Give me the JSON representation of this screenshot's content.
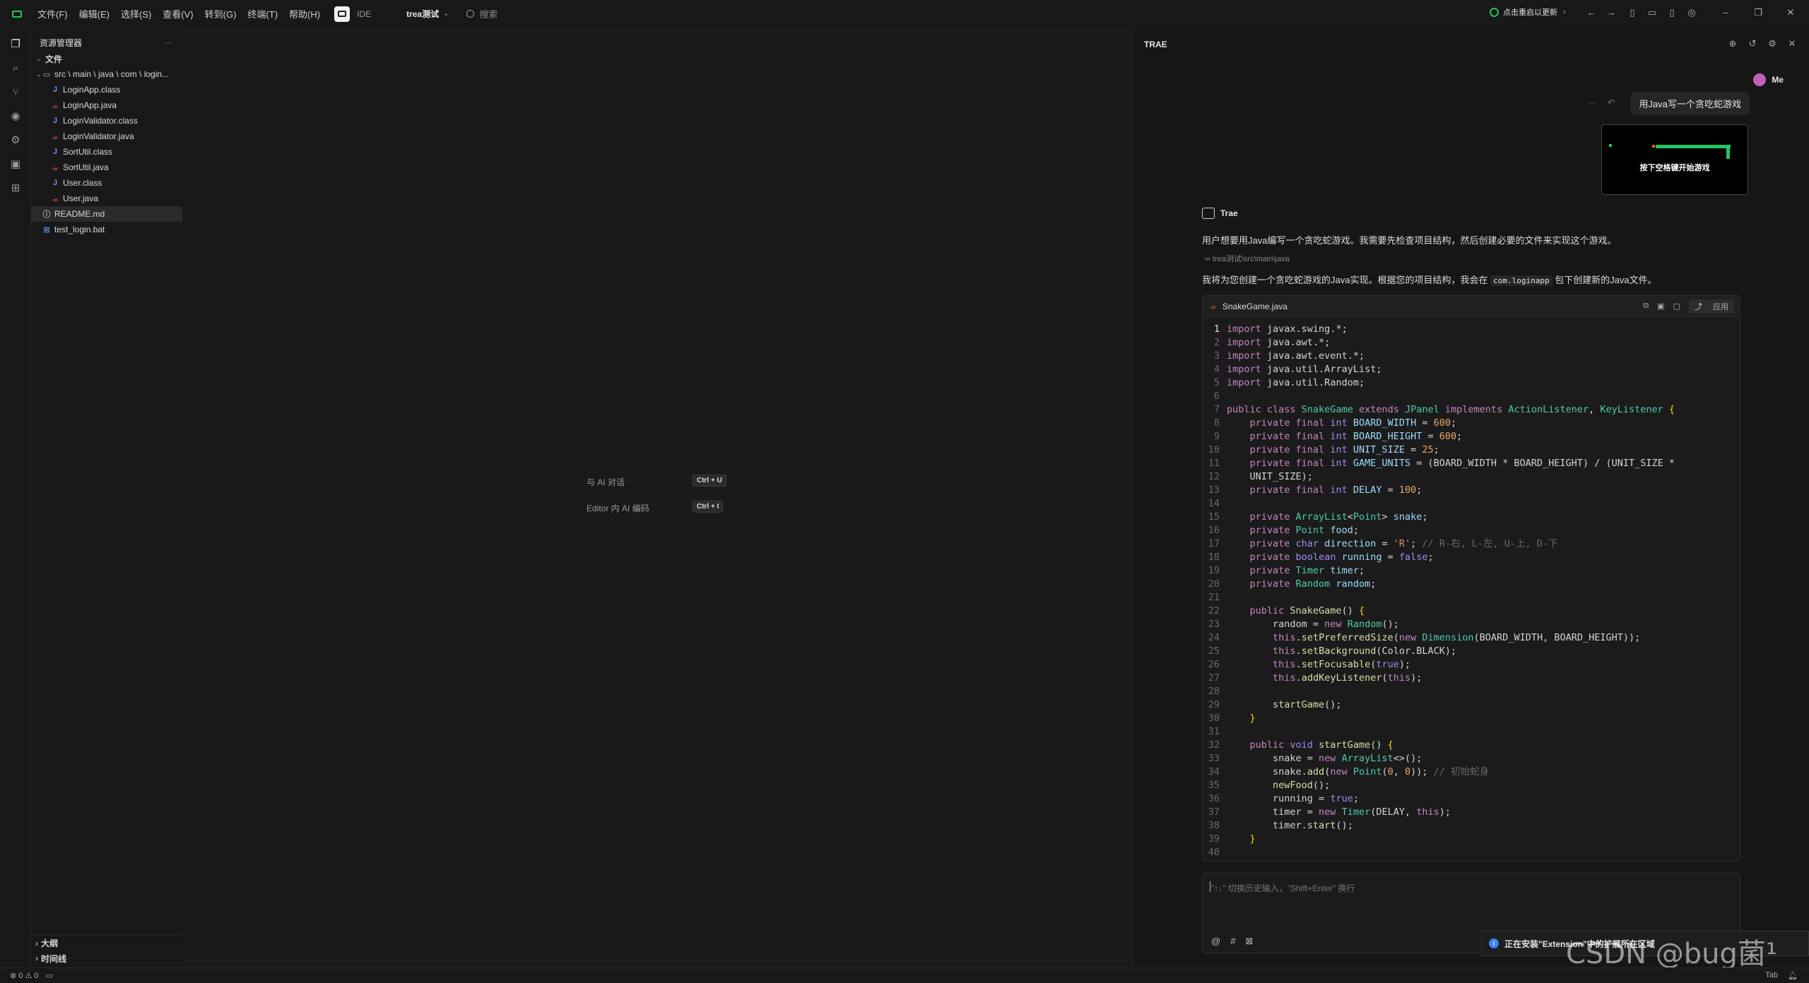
{
  "menu": [
    "文件(F)",
    "编辑(E)",
    "选择(S)",
    "查看(V)",
    "转到(G)",
    "终端(T)",
    "帮助(H)"
  ],
  "mode_label": "IDE",
  "project_name": "trea测试",
  "search_label": "搜索",
  "update_label": "点击重启以更新",
  "explorer": {
    "title": "资源管理器",
    "section": "文件",
    "folder": "src \\ main \\ java \\ com \\ login...",
    "files": [
      "LoginApp.class",
      "LoginApp.java",
      "LoginValidator.class",
      "LoginValidator.java",
      "SortUtil.class",
      "SortUtil.java",
      "User.class",
      "User.java"
    ],
    "root_files": [
      "README.md",
      "test_login.bat"
    ],
    "outline": "大纲",
    "timeline": "时间线"
  },
  "editor_hints": {
    "chat": {
      "label": "与 AI 对话",
      "key": "Ctrl + U"
    },
    "inline": {
      "label": "Editor 内 AI 编码",
      "key": "Ctrl + I"
    }
  },
  "ai": {
    "title": "TRAE",
    "user_name": "Me",
    "user_message": "用Java写一个贪吃蛇游戏",
    "thumb_text": "按下空格键开始游戏",
    "assistant_name": "Trae",
    "text1": "用户想要用Java编写一个贪吃蛇游戏。我需要先检查项目结构，然后创建必要的文件来实现这个游戏。",
    "path": "trea测试\\src\\main\\java",
    "text2_before": "我将为您创建一个贪吃蛇游戏的Java实现。根据您的项目结构，我会在",
    "text2_code": "com.loginapp",
    "text2_after": "包下创建新的Java文件。",
    "file_name": "SnakeGame.java",
    "apply_label": "应用",
    "input_placeholder": "\"↑↓\" 切换历史输入，\"Shift+Enter\" 换行"
  },
  "code": [
    [
      [
        "kw",
        "import"
      ],
      [
        "ct",
        " javax.swing.*;"
      ]
    ],
    [
      [
        "kw",
        "import"
      ],
      [
        "ct",
        " java.awt.*;"
      ]
    ],
    [
      [
        "kw",
        "import"
      ],
      [
        "ct",
        " java.awt.event.*;"
      ]
    ],
    [
      [
        "kw",
        "import"
      ],
      [
        "ct",
        " java.util.ArrayList;"
      ]
    ],
    [
      [
        "kw",
        "import"
      ],
      [
        "ct",
        " java.util.Random;"
      ]
    ],
    [],
    [
      [
        "kw",
        "public class "
      ],
      [
        "ty",
        "SnakeGame"
      ],
      [
        "kw",
        " extends "
      ],
      [
        "ty",
        "JPanel"
      ],
      [
        "kw",
        " implements "
      ],
      [
        "ty",
        "ActionListener"
      ],
      [
        "ct",
        ", "
      ],
      [
        "ty",
        "KeyListener"
      ],
      [
        "pn",
        " {"
      ]
    ],
    [
      [
        "kw",
        "    private final "
      ],
      [
        "kb",
        "int "
      ],
      [
        "id",
        "BOARD_WIDTH"
      ],
      [
        "ct",
        " = "
      ],
      [
        "num",
        "600"
      ],
      [
        "ct",
        ";"
      ]
    ],
    [
      [
        "kw",
        "    private final "
      ],
      [
        "kb",
        "int "
      ],
      [
        "id",
        "BOARD_HEIGHT"
      ],
      [
        "ct",
        " = "
      ],
      [
        "num",
        "600"
      ],
      [
        "ct",
        ";"
      ]
    ],
    [
      [
        "kw",
        "    private final "
      ],
      [
        "kb",
        "int "
      ],
      [
        "id",
        "UNIT_SIZE"
      ],
      [
        "ct",
        " = "
      ],
      [
        "num",
        "25"
      ],
      [
        "ct",
        ";"
      ]
    ],
    [
      [
        "kw",
        "    private final "
      ],
      [
        "kb",
        "int "
      ],
      [
        "id",
        "GAME_UNITS"
      ],
      [
        "ct",
        " = (BOARD_WIDTH * BOARD_HEIGHT) / (UNIT_SIZE *"
      ]
    ],
    [
      [
        "ct",
        "    UNIT_SIZE);"
      ]
    ],
    [
      [
        "kw",
        "    private final "
      ],
      [
        "kb",
        "int "
      ],
      [
        "id",
        "DELAY"
      ],
      [
        "ct",
        " = "
      ],
      [
        "num",
        "100"
      ],
      [
        "ct",
        ";"
      ]
    ],
    [],
    [
      [
        "kw",
        "    private "
      ],
      [
        "ty",
        "ArrayList"
      ],
      [
        "ct",
        "<"
      ],
      [
        "ty",
        "Point"
      ],
      [
        "ct",
        "> "
      ],
      [
        "id",
        "snake"
      ],
      [
        "ct",
        ";"
      ]
    ],
    [
      [
        "kw",
        "    private "
      ],
      [
        "ty",
        "Point "
      ],
      [
        "id",
        "food"
      ],
      [
        "ct",
        ";"
      ]
    ],
    [
      [
        "kw",
        "    private "
      ],
      [
        "kb",
        "char "
      ],
      [
        "id",
        "direction"
      ],
      [
        "ct",
        " = "
      ],
      [
        "str",
        "'R'"
      ],
      [
        "ct",
        "; "
      ],
      [
        "cm",
        "// R-右, L-左, U-上, D-下"
      ]
    ],
    [
      [
        "kw",
        "    private "
      ],
      [
        "kb",
        "boolean "
      ],
      [
        "id",
        "running"
      ],
      [
        "ct",
        " = "
      ],
      [
        "kb",
        "false"
      ],
      [
        "ct",
        ";"
      ]
    ],
    [
      [
        "kw",
        "    private "
      ],
      [
        "ty",
        "Timer "
      ],
      [
        "id",
        "timer"
      ],
      [
        "ct",
        ";"
      ]
    ],
    [
      [
        "kw",
        "    private "
      ],
      [
        "ty",
        "Random "
      ],
      [
        "id",
        "random"
      ],
      [
        "ct",
        ";"
      ]
    ],
    [],
    [
      [
        "kw",
        "    public "
      ],
      [
        "fn",
        "SnakeGame"
      ],
      [
        "ct",
        "() "
      ],
      [
        "pn",
        "{"
      ]
    ],
    [
      [
        "ct",
        "        random = "
      ],
      [
        "kw",
        "new "
      ],
      [
        "ty",
        "Random"
      ],
      [
        "ct",
        "();"
      ]
    ],
    [
      [
        "kw",
        "        this"
      ],
      [
        "ct",
        "."
      ],
      [
        "fn",
        "setPreferredSize"
      ],
      [
        "ct",
        "("
      ],
      [
        "kw",
        "new "
      ],
      [
        "ty",
        "Dimension"
      ],
      [
        "ct",
        "(BOARD_WIDTH, BOARD_HEIGHT));"
      ]
    ],
    [
      [
        "kw",
        "        this"
      ],
      [
        "ct",
        "."
      ],
      [
        "fn",
        "setBackground"
      ],
      [
        "ct",
        "(Color.BLACK);"
      ]
    ],
    [
      [
        "kw",
        "        this"
      ],
      [
        "ct",
        "."
      ],
      [
        "fn",
        "setFocusable"
      ],
      [
        "ct",
        "("
      ],
      [
        "kb",
        "true"
      ],
      [
        "ct",
        ");"
      ]
    ],
    [
      [
        "kw",
        "        this"
      ],
      [
        "ct",
        "."
      ],
      [
        "fn",
        "addKeyListener"
      ],
      [
        "ct",
        "("
      ],
      [
        "kw",
        "this"
      ],
      [
        "ct",
        ");"
      ]
    ],
    [],
    [
      [
        "fn",
        "        startGame"
      ],
      [
        "ct",
        "();"
      ]
    ],
    [
      [
        "pn",
        "    }"
      ]
    ],
    [],
    [
      [
        "kw",
        "    public "
      ],
      [
        "kb",
        "void "
      ],
      [
        "fn",
        "startGame"
      ],
      [
        "ct",
        "() "
      ],
      [
        "pn",
        "{"
      ]
    ],
    [
      [
        "ct",
        "        snake = "
      ],
      [
        "kw",
        "new "
      ],
      [
        "ty",
        "ArrayList"
      ],
      [
        "ct",
        "<>();"
      ]
    ],
    [
      [
        "ct",
        "        snake."
      ],
      [
        "fn",
        "add"
      ],
      [
        "ct",
        "("
      ],
      [
        "kw",
        "new "
      ],
      [
        "ty",
        "Point"
      ],
      [
        "ct",
        "("
      ],
      [
        "num",
        "0"
      ],
      [
        "ct",
        ", "
      ],
      [
        "num",
        "0"
      ],
      [
        "ct",
        "));"
      ],
      [
        "cm",
        " // 初始蛇身"
      ]
    ],
    [
      [
        "fn",
        "        newFood"
      ],
      [
        "ct",
        "();"
      ]
    ],
    [
      [
        "ct",
        "        running = "
      ],
      [
        "kb",
        "true"
      ],
      [
        "ct",
        ";"
      ]
    ],
    [
      [
        "ct",
        "        timer = "
      ],
      [
        "kw",
        "new "
      ],
      [
        "ty",
        "Timer"
      ],
      [
        "ct",
        "(DELAY, "
      ],
      [
        "kw",
        "this"
      ],
      [
        "ct",
        ");"
      ]
    ],
    [
      [
        "ct",
        "        timer."
      ],
      [
        "fn",
        "start"
      ],
      [
        "ct",
        "();"
      ]
    ],
    [
      [
        "pn",
        "    }"
      ]
    ],
    []
  ],
  "toast": "正在安装\"Extension\"中的扩展所在区域",
  "watermark": "CSDN @bug菌¹",
  "status": {
    "errors": "0",
    "warnings": "0",
    "tab": "Tab"
  }
}
